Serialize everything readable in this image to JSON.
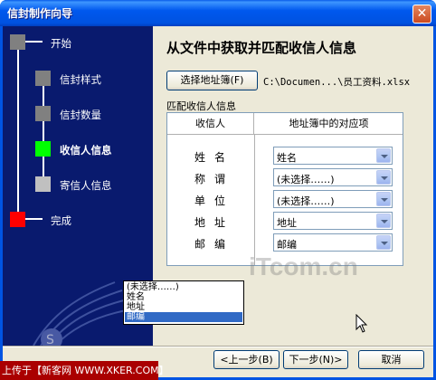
{
  "window": {
    "title": "信封制作向导",
    "close_glyph": "✕"
  },
  "sidebar": {
    "steps": [
      {
        "label": "开始",
        "color": "#808080"
      },
      {
        "label": "信封样式",
        "color": "#808080"
      },
      {
        "label": "信封数量",
        "color": "#808080"
      },
      {
        "label": "收信人信息",
        "color": "#00ff00",
        "active": true
      },
      {
        "label": "寄信人信息",
        "color": "#c0c0c0"
      },
      {
        "label": "完成",
        "color": "#ff0000"
      }
    ],
    "watermark_wings_icon": "wings-icon"
  },
  "main": {
    "heading": "从文件中获取并匹配收信人信息",
    "select_address_button": "选择地址簿(F)",
    "file_path": "C:\\Documen...\\员工资料.xlsx",
    "group_label": "匹配收信人信息",
    "grid": {
      "headers": [
        "收信人",
        "地址簿中的对应项"
      ],
      "rows": [
        {
          "label": "姓名",
          "value": "姓名"
        },
        {
          "label": "称谓",
          "value": "(未选择……)"
        },
        {
          "label": "单位",
          "value": "(未选择……)"
        },
        {
          "label": "地址",
          "value": "地址"
        },
        {
          "label": "邮编",
          "value": "邮编"
        }
      ]
    },
    "dropdown": {
      "options": [
        "(未选择……)",
        "姓名",
        "地址",
        "邮编"
      ],
      "selected": "邮编"
    }
  },
  "footer": {
    "back_button": "<上一步(B)",
    "next_button": "下一步(N)>",
    "cancel_button": "取消"
  },
  "watermarks": {
    "itcom": "iTcom.cn",
    "bottom": "上传于【新客网 WWW.XKER.COM】"
  },
  "colors": {
    "title_blue": "#0054e3",
    "sidebar_navy": "#091a6e",
    "selection": "#316ac5"
  }
}
